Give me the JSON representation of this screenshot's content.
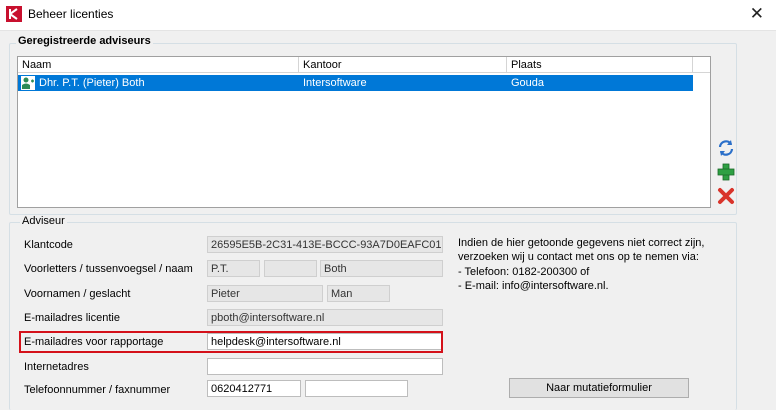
{
  "window": {
    "title": "Beheer licenties"
  },
  "registered": {
    "group_label": "Geregistreerde adviseurs",
    "columns": [
      "Naam",
      "Kantoor",
      "Plaats"
    ],
    "rows": [
      {
        "naam": "Dhr. P.T. (Pieter) Both",
        "kantoor": "Intersoftware",
        "plaats": "Gouda"
      }
    ]
  },
  "advisor": {
    "group_label": "Adviseur",
    "labels": {
      "klantcode": "Klantcode",
      "voorletters": "Voorletters / tussenvoegsel / naam",
      "voornamen": "Voornamen / geslacht",
      "email_licentie": "E-mailadres licentie",
      "email_rapportage": "E-mailadres voor rapportage",
      "internetadres": "Internetadres",
      "telefoon": "Telefoonnummer / faxnummer"
    },
    "values": {
      "klantcode": "26595E5B-2C31-413E-BCCC-93A7D0EAFC01",
      "voorletters": "P.T.",
      "tussenvoegsel": "",
      "achternaam": "Both",
      "voornamen": "Pieter",
      "geslacht": "Man",
      "email_licentie": "pboth@intersoftware.nl",
      "email_rapportage": "helpdesk@intersoftware.nl",
      "internetadres": "",
      "telefoon": "0620412771",
      "faxnummer": ""
    },
    "info_lines": [
      "Indien de hier getoonde gegevens niet correct zijn,",
      "verzoeken wij u contact met ons op te nemen via:",
      "- Telefoon: 0182-200300 of",
      "- E-mail: info@intersoftware.nl."
    ],
    "mutation_button": "Naar mutatieformulier"
  },
  "icons": [
    "app-logo-icon",
    "close-icon",
    "person-icon",
    "refresh-icon",
    "add-icon",
    "delete-icon"
  ],
  "colors": {
    "selection": "#0078d7",
    "highlight_border": "#d4111a",
    "add_green": "#2ea043",
    "delete_red": "#d9342b"
  }
}
